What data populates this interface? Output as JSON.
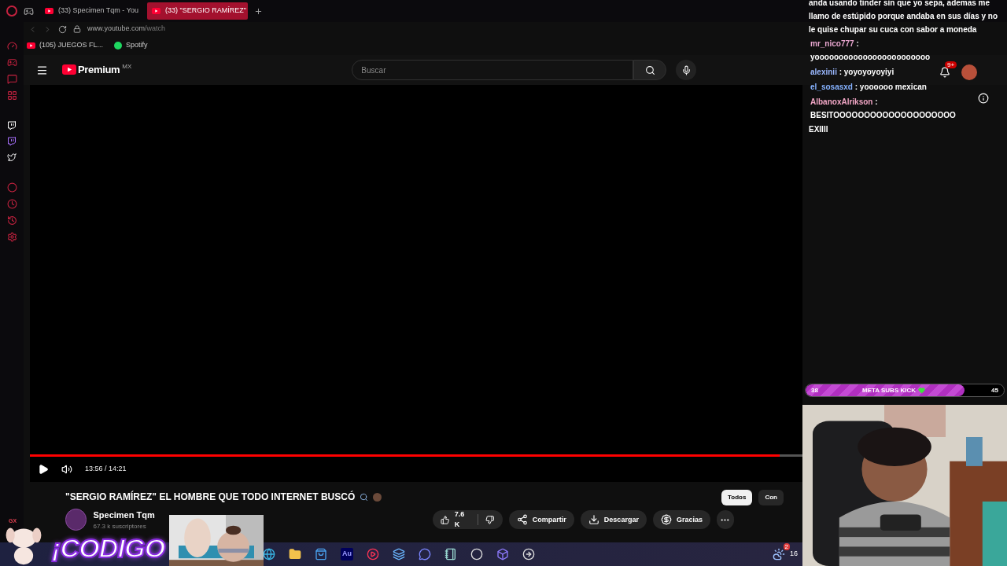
{
  "browser": {
    "tabs": [
      {
        "label": "(33) Specimen Tqm - You",
        "selected": false
      },
      {
        "label": "(33) \"SERGIO RAMÍREZ\"",
        "selected": true
      }
    ],
    "url_host": "www.youtube.com",
    "url_path": "/watch",
    "bookmarks": [
      {
        "label": "(105) JUEGOS FL...",
        "kind": "youtube"
      },
      {
        "label": "Spotify",
        "kind": "spotify"
      }
    ]
  },
  "youtube": {
    "logo": "Premium",
    "region": "MX",
    "search_placeholder": "Buscar",
    "notification_badge": "9+"
  },
  "player": {
    "level": 0.97,
    "time": "13:56 / 14:21"
  },
  "video": {
    "title": "\"SERGIO RAMÍREZ\" EL HOMBRE QUE TODO INTERNET BUSCÓ",
    "channel": "Specimen Tqm",
    "subscribers": "67.3 k suscriptores",
    "likes": "7.6 K",
    "actions": [
      {
        "label": "Compartir",
        "kind": "share"
      },
      {
        "label": "Descargar",
        "kind": "download"
      },
      {
        "label": "Gracias",
        "kind": "thanks"
      }
    ]
  },
  "chips": [
    {
      "label": "Todos",
      "selected": true
    },
    {
      "label": "Con",
      "selected": false
    }
  ],
  "chat": {
    "lines": [
      {
        "kind": "text",
        "text": "anda usando tinder sin que yo sepa, ademas me llamo de estúpido porque andaba en sus días y no le quise chupar su cuca con sabor a moneda"
      },
      {
        "kind": "message",
        "user": "mr_nico777",
        "color": "#e8a6cf",
        "separator": ":",
        "text": "yoooooooooooooooooooooooo"
      },
      {
        "kind": "message",
        "user": "alexinii",
        "color": "#9ab8ff",
        "separator": ":",
        "text": "yoyoyoyoyiyi"
      },
      {
        "kind": "message",
        "user": "el_sosasxd",
        "color": "#86b2ff",
        "separator": ":",
        "text": "yoooooo mexican"
      },
      {
        "kind": "message",
        "user": "AlbanoxAlrikson",
        "color": "#f2a7c6",
        "separator": ":",
        "text": "BESITOOOOOOOOOOOOOOOOOOOO"
      },
      {
        "kind": "text",
        "text": "EXIIII"
      }
    ]
  },
  "goal": {
    "start": "38",
    "label": "META SUBS KICK",
    "end": "45",
    "level": 0.8
  },
  "sticker": {
    "tag": "GX",
    "text": "¡CODIGO"
  },
  "taskbar": {
    "apps": [
      {
        "kind": "edge"
      },
      {
        "kind": "folder"
      },
      {
        "kind": "store"
      },
      {
        "kind": "audition",
        "label": "Au"
      },
      {
        "kind": "player"
      },
      {
        "kind": "editor"
      },
      {
        "kind": "discord"
      },
      {
        "kind": "notes"
      },
      {
        "kind": "obs"
      },
      {
        "kind": "app"
      },
      {
        "kind": "arrow"
      }
    ],
    "weather_badge": "2",
    "clock": "16"
  }
}
